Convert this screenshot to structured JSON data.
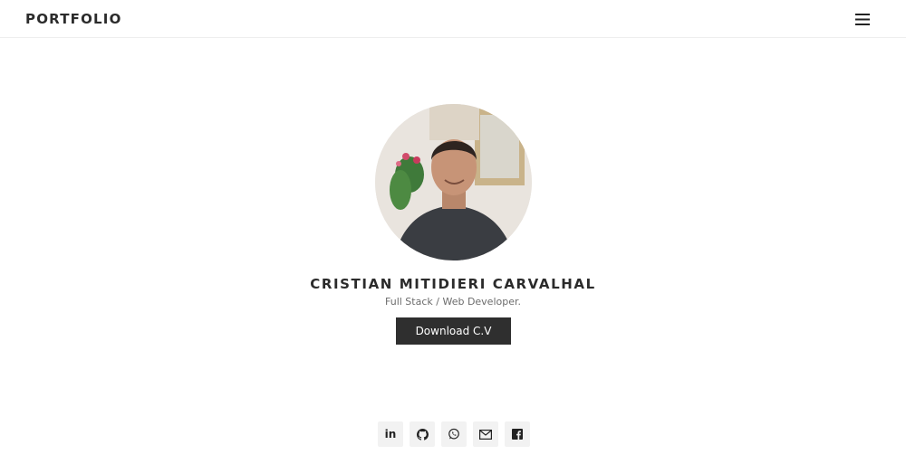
{
  "header": {
    "brand": "PORTFOLIO",
    "menu_icon": "hamburger-menu-icon"
  },
  "profile": {
    "photo": "profile-photo",
    "name": "CRISTIAN MITIDIERI CARVALHAL",
    "role": "Full Stack / Web Developer.",
    "download_label": "Download C.V"
  },
  "social": {
    "linkedin_label": "in",
    "icons": [
      "linkedin-icon",
      "github-icon",
      "whatsapp-icon",
      "email-icon",
      "facebook-icon"
    ]
  },
  "colors": {
    "text_dark": "#2b2b2b",
    "text_muted": "#6c6c6c",
    "button_bg": "#2f2f2f",
    "social_bg": "#f2f2f2"
  }
}
